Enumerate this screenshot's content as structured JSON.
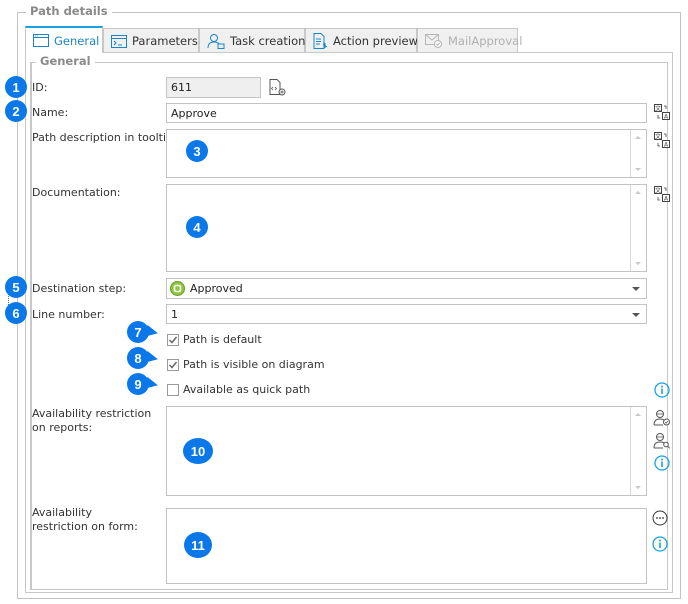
{
  "group_title": "Path details",
  "tabs": [
    {
      "label": "General",
      "icon": "window-icon",
      "active": true,
      "disabled": false
    },
    {
      "label": "Parameters",
      "icon": "console-icon",
      "active": false,
      "disabled": false
    },
    {
      "label": "Task creation",
      "icon": "user-task-icon",
      "active": false,
      "disabled": false
    },
    {
      "label": "Action preview",
      "icon": "document-preview-icon",
      "active": false,
      "disabled": false
    },
    {
      "label": "MailApproval",
      "icon": "mail-check-icon",
      "active": false,
      "disabled": true
    }
  ],
  "section_title": "General",
  "fields": {
    "id": {
      "label": "ID:",
      "value": "611",
      "badge": "1"
    },
    "name": {
      "label": "Name:",
      "value": "Approve",
      "badge": "2"
    },
    "tooltip": {
      "label": "Path description in tooltip:",
      "value": "",
      "badge": "3"
    },
    "documentation": {
      "label": "Documentation:",
      "value": "",
      "badge": "4"
    },
    "destination": {
      "label": "Destination step:",
      "value": "Approved",
      "badge": "5"
    },
    "line_number": {
      "label": "Line number:",
      "value": "1",
      "badge": "6"
    },
    "path_default": {
      "label": "Path is default",
      "checked": true,
      "badge": "7"
    },
    "path_visible": {
      "label": "Path is visible on diagram",
      "checked": true,
      "badge": "8"
    },
    "quick_path": {
      "label": "Available as quick path",
      "checked": false,
      "badge": "9"
    },
    "reports_restriction": {
      "label": "Availability restriction on reports:",
      "value": "",
      "badge": "10"
    },
    "form_restriction": {
      "label": "Availability restriction on form:",
      "value": "",
      "badge": "11"
    }
  },
  "colors": {
    "accent": "#1ba1e2",
    "badge": "#0a78e8",
    "step_icon": "#8dc63f",
    "info_icon": "#1ba1e2"
  }
}
